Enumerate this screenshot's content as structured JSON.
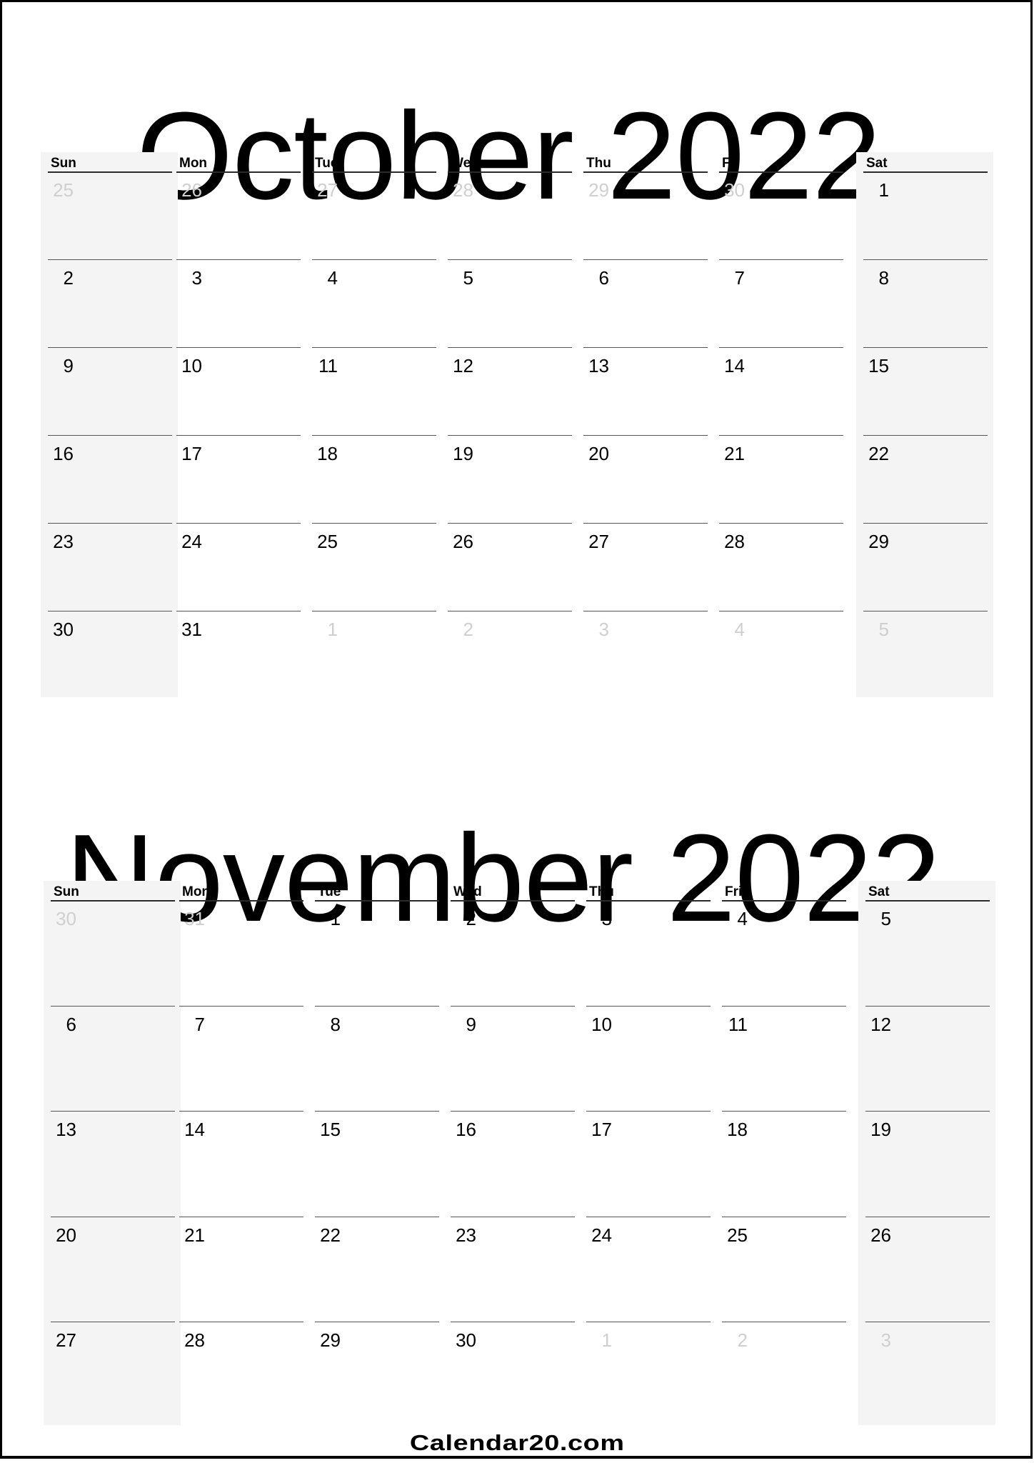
{
  "weekdays": [
    "Sun",
    "Mon",
    "Tue",
    "Wed",
    "Thu",
    "Fri",
    "Sat"
  ],
  "months": [
    {
      "title": "October 2022",
      "weeks": [
        [
          {
            "d": "25",
            "muted": true
          },
          {
            "d": "26",
            "muted": true
          },
          {
            "d": "27",
            "muted": true
          },
          {
            "d": "28",
            "muted": true
          },
          {
            "d": "29",
            "muted": true
          },
          {
            "d": "30",
            "muted": true
          },
          {
            "d": "1",
            "muted": false
          }
        ],
        [
          {
            "d": "2",
            "muted": false
          },
          {
            "d": "3",
            "muted": false
          },
          {
            "d": "4",
            "muted": false
          },
          {
            "d": "5",
            "muted": false
          },
          {
            "d": "6",
            "muted": false
          },
          {
            "d": "7",
            "muted": false
          },
          {
            "d": "8",
            "muted": false
          }
        ],
        [
          {
            "d": "9",
            "muted": false
          },
          {
            "d": "10",
            "muted": false
          },
          {
            "d": "11",
            "muted": false
          },
          {
            "d": "12",
            "muted": false
          },
          {
            "d": "13",
            "muted": false
          },
          {
            "d": "14",
            "muted": false
          },
          {
            "d": "15",
            "muted": false
          }
        ],
        [
          {
            "d": "16",
            "muted": false
          },
          {
            "d": "17",
            "muted": false
          },
          {
            "d": "18",
            "muted": false
          },
          {
            "d": "19",
            "muted": false
          },
          {
            "d": "20",
            "muted": false
          },
          {
            "d": "21",
            "muted": false
          },
          {
            "d": "22",
            "muted": false
          }
        ],
        [
          {
            "d": "23",
            "muted": false
          },
          {
            "d": "24",
            "muted": false
          },
          {
            "d": "25",
            "muted": false
          },
          {
            "d": "26",
            "muted": false
          },
          {
            "d": "27",
            "muted": false
          },
          {
            "d": "28",
            "muted": false
          },
          {
            "d": "29",
            "muted": false
          }
        ],
        [
          {
            "d": "30",
            "muted": false
          },
          {
            "d": "31",
            "muted": false
          },
          {
            "d": "1",
            "muted": true
          },
          {
            "d": "2",
            "muted": true
          },
          {
            "d": "3",
            "muted": true
          },
          {
            "d": "4",
            "muted": true
          },
          {
            "d": "5",
            "muted": true
          }
        ]
      ]
    },
    {
      "title": "November 2022",
      "weeks": [
        [
          {
            "d": "30",
            "muted": true
          },
          {
            "d": "31",
            "muted": true
          },
          {
            "d": "1",
            "muted": false
          },
          {
            "d": "2",
            "muted": false
          },
          {
            "d": "3",
            "muted": false
          },
          {
            "d": "4",
            "muted": false
          },
          {
            "d": "5",
            "muted": false
          }
        ],
        [
          {
            "d": "6",
            "muted": false
          },
          {
            "d": "7",
            "muted": false
          },
          {
            "d": "8",
            "muted": false
          },
          {
            "d": "9",
            "muted": false
          },
          {
            "d": "10",
            "muted": false
          },
          {
            "d": "11",
            "muted": false
          },
          {
            "d": "12",
            "muted": false
          }
        ],
        [
          {
            "d": "13",
            "muted": false
          },
          {
            "d": "14",
            "muted": false
          },
          {
            "d": "15",
            "muted": false
          },
          {
            "d": "16",
            "muted": false
          },
          {
            "d": "17",
            "muted": false
          },
          {
            "d": "18",
            "muted": false
          },
          {
            "d": "19",
            "muted": false
          }
        ],
        [
          {
            "d": "20",
            "muted": false
          },
          {
            "d": "21",
            "muted": false
          },
          {
            "d": "22",
            "muted": false
          },
          {
            "d": "23",
            "muted": false
          },
          {
            "d": "24",
            "muted": false
          },
          {
            "d": "25",
            "muted": false
          },
          {
            "d": "26",
            "muted": false
          }
        ],
        [
          {
            "d": "27",
            "muted": false
          },
          {
            "d": "28",
            "muted": false
          },
          {
            "d": "29",
            "muted": false
          },
          {
            "d": "30",
            "muted": false
          },
          {
            "d": "1",
            "muted": true
          },
          {
            "d": "2",
            "muted": true
          },
          {
            "d": "3",
            "muted": true
          }
        ]
      ]
    }
  ],
  "footer": "Calendar20.com",
  "colors": {
    "weekend_shade": "#f4f4f4",
    "muted_day": "#cfcfcf",
    "text": "#000000"
  }
}
